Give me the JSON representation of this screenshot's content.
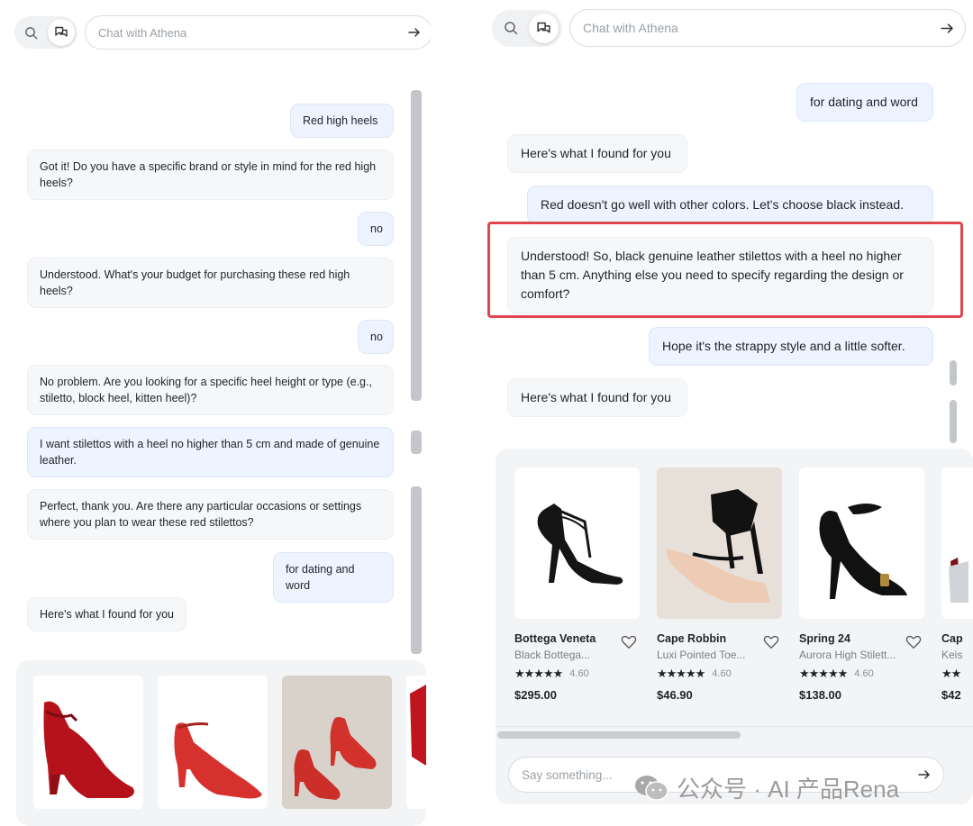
{
  "search_placeholder": "Chat with Athena",
  "left": {
    "messages": [
      {
        "role": "user",
        "text": "Red high heels"
      },
      {
        "role": "bot",
        "text": "Got it! Do you have a specific brand or style in mind for the red high heels?"
      },
      {
        "role": "user",
        "text": "no"
      },
      {
        "role": "bot",
        "text": "Understood. What's your budget for purchasing these red high heels?"
      },
      {
        "role": "user",
        "text": "no"
      },
      {
        "role": "bot",
        "text": "No problem. Are you looking for a specific heel height or type (e.g., stiletto, block heel, kitten heel)?"
      },
      {
        "role": "user",
        "text": "I want stilettos with a heel no higher than 5 cm and made of genuine leather."
      },
      {
        "role": "bot",
        "text": "Perfect, thank you. Are there any particular occasions or settings where you plan to wear these red stilettos?"
      },
      {
        "role": "user",
        "text": "for dating and word"
      },
      {
        "role": "bot",
        "text": "Here's what I found for you"
      }
    ]
  },
  "right": {
    "messages": [
      {
        "role": "user",
        "text": "for dating and word"
      },
      {
        "role": "bot",
        "text": "Here's what I found for you"
      },
      {
        "role": "user",
        "text": "Red doesn't go well with other colors. Let's choose black instead."
      },
      {
        "role": "bot",
        "text": "Understood! So, black genuine leather stilettos with a heel no higher than 5 cm. Anything else you need to specify regarding the design or comfort?"
      },
      {
        "role": "user",
        "text": "Hope it's the strappy style and a little softer."
      },
      {
        "role": "bot",
        "text": "Here's what I found for you"
      }
    ],
    "products": [
      {
        "brand": "Bottega Veneta",
        "name": "Black Bottega...",
        "stars": "★★★★★",
        "rating": "4.60",
        "price": "$295.00"
      },
      {
        "brand": "Cape Robbin",
        "name": "Luxi Pointed Toe...",
        "stars": "★★★★★",
        "rating": "4.60",
        "price": "$46.90"
      },
      {
        "brand": "Spring 24",
        "name": "Aurora High Stilett...",
        "stars": "★★★★★",
        "rating": "4.60",
        "price": "$138.00"
      },
      {
        "brand": "Cap",
        "name": "Keis",
        "stars": "★★",
        "rating": "",
        "price": "$42"
      }
    ],
    "say_placeholder": "Say something..."
  },
  "watermark": "公众号 · AI 产品Rena",
  "colors": {
    "accent_red": "#e0464e",
    "user_bubble": "#eef4ff",
    "bot_bubble": "#f6f7f9"
  },
  "icons": [
    "search-icon",
    "chat-icon",
    "send-arrow-icon",
    "heart-icon",
    "star-icon",
    "wechat-icon"
  ]
}
